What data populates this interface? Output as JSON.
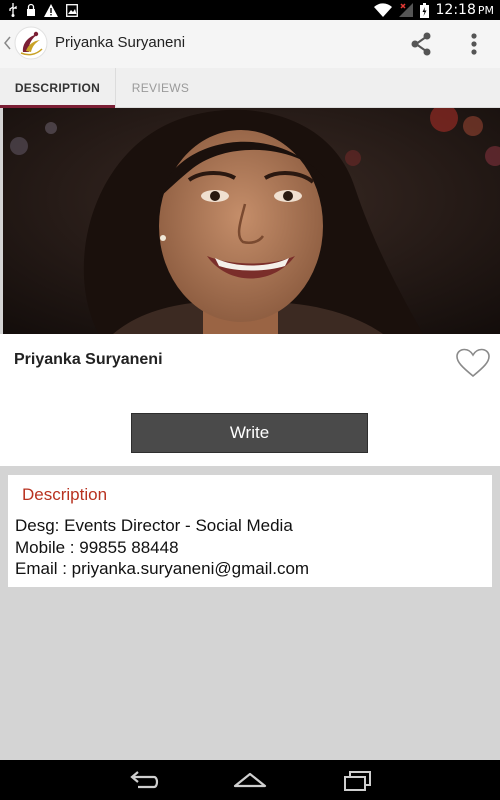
{
  "status_bar": {
    "time": "12:18",
    "time_suffix": "PM"
  },
  "action_bar": {
    "title": "Priyanka Suryaneni"
  },
  "tabs": [
    {
      "label": "DESCRIPTION",
      "active": true
    },
    {
      "label": "REVIEWS",
      "active": false
    }
  ],
  "profile": {
    "name": "Priyanka Suryaneni",
    "favorited": false
  },
  "write_button": {
    "label": "Write"
  },
  "description": {
    "heading": "Description",
    "designation": "Desg: Events Director - Social Media",
    "mobile": "Mobile : 99855 88448",
    "email": "Email : priyanka.suryaneni@gmail.com"
  },
  "colors": {
    "accent": "#7b1f35",
    "heading_red": "#b83220",
    "button_dark": "#4a4a4a"
  },
  "icons": {
    "status_left": [
      "usb-icon",
      "lock-icon",
      "warning-icon",
      "image-icon"
    ],
    "status_right": [
      "wifi-icon",
      "signal-icon",
      "battery-icon"
    ],
    "nav": [
      "back-icon",
      "home-icon",
      "recents-icon"
    ]
  }
}
